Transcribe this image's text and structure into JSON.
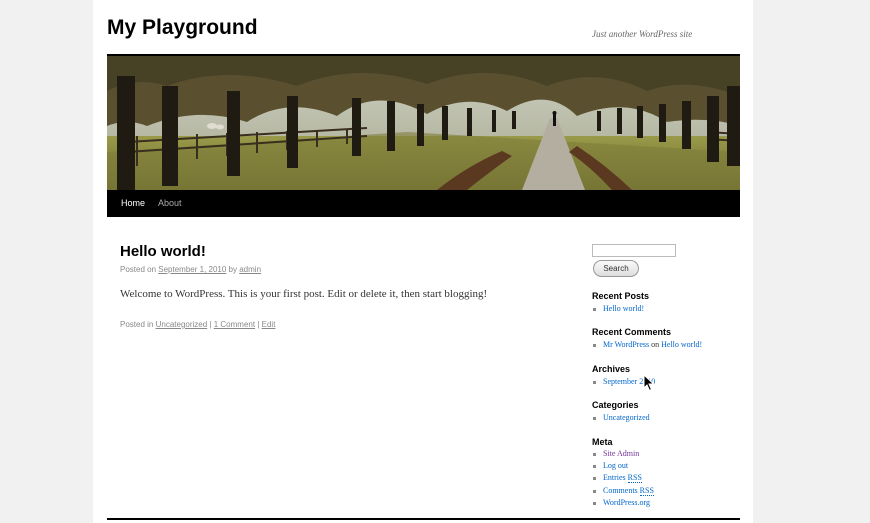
{
  "site": {
    "title": "My Playground",
    "description": "Just another WordPress site"
  },
  "menu": [
    {
      "label": "Home",
      "current": true
    },
    {
      "label": "About",
      "current": false
    }
  ],
  "post": {
    "title": "Hello world!",
    "posted_on": "Posted on",
    "date": "September 1, 2010",
    "by": "by",
    "author": "admin",
    "content": "Welcome to WordPress. This is your first post. Edit or delete it, then start blogging!",
    "posted_in": "Posted in",
    "category": "Uncategorized",
    "sep1": "|",
    "comments": "1 Comment",
    "sep2": "|",
    "edit": "Edit"
  },
  "sidebar": {
    "search": {
      "value": "",
      "button": "Search"
    },
    "recent_posts": {
      "title": "Recent Posts",
      "items": [
        "Hello world!"
      ]
    },
    "recent_comments": {
      "title": "Recent Comments",
      "author": "Mr WordPress",
      "on": "on",
      "post": "Hello world!"
    },
    "archives": {
      "title": "Archives",
      "items": [
        "September 2010"
      ]
    },
    "categories": {
      "title": "Categories",
      "items": [
        "Uncategorized"
      ]
    },
    "meta": {
      "title": "Meta",
      "site_admin": "Site Admin",
      "log_out": "Log out",
      "entries": "Entries",
      "comments": "Comments",
      "rss": "RSS",
      "wordpress": "WordPress.org"
    }
  },
  "colors": {
    "link": "#0066cc",
    "visited_link": "#743399",
    "menu_bar": "#000000"
  }
}
